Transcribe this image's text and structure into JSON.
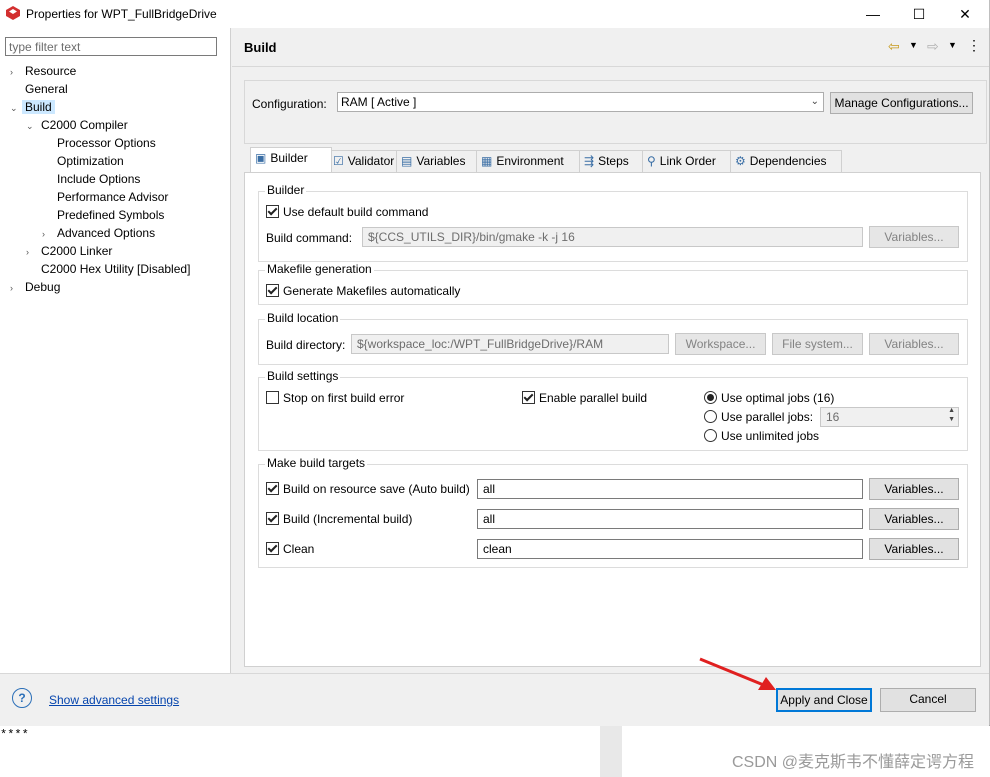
{
  "window": {
    "title": "Properties for WPT_FullBridgeDrive",
    "minimize": "—",
    "maximize": "☐",
    "close": "✕"
  },
  "filter": {
    "placeholder": "type filter text"
  },
  "tree": [
    {
      "label": "Resource",
      "chevron": "›"
    },
    {
      "label": "General",
      "chevron": ""
    },
    {
      "label": "Build",
      "chevron": "⌄",
      "selected": true
    },
    {
      "label": "C2000 Compiler",
      "chevron": "⌄"
    },
    {
      "label": "Processor Options",
      "chevron": ""
    },
    {
      "label": "Optimization",
      "chevron": ""
    },
    {
      "label": "Include Options",
      "chevron": ""
    },
    {
      "label": "Performance Advisor",
      "chevron": ""
    },
    {
      "label": "Predefined Symbols",
      "chevron": ""
    },
    {
      "label": "Advanced Options",
      "chevron": "›"
    },
    {
      "label": "C2000 Linker",
      "chevron": "›"
    },
    {
      "label": "C2000 Hex Utility  [Disabled]",
      "chevron": ""
    },
    {
      "label": "Debug",
      "chevron": "›"
    }
  ],
  "page": {
    "title": "Build"
  },
  "configuration": {
    "label": "Configuration:",
    "value": "RAM  [ Active ]",
    "manage_button": "Manage Configurations..."
  },
  "tabs": [
    "Builder",
    "Validator",
    "Variables",
    "Environment",
    "Steps",
    "Link Order",
    "Dependencies"
  ],
  "builder": {
    "group_title": "Builder",
    "use_default": "Use default build command",
    "build_command_label": "Build command:",
    "build_command_value": "${CCS_UTILS_DIR}/bin/gmake -k -j 16",
    "variables": "Variables..."
  },
  "makefile": {
    "group_title": "Makefile generation",
    "generate": "Generate Makefiles automatically"
  },
  "location": {
    "group_title": "Build location",
    "dir_label": "Build directory:",
    "dir_value": "${workspace_loc:/WPT_FullBridgeDrive}/RAM",
    "workspace": "Workspace...",
    "filesystem": "File system...",
    "variables": "Variables..."
  },
  "settings": {
    "group_title": "Build settings",
    "stop_on_error": "Stop on first build error",
    "parallel": "Enable parallel build",
    "optimal": "Use optimal jobs (16)",
    "parallel_jobs": "Use parallel jobs:",
    "jobs_value": "16",
    "unlimited": "Use unlimited jobs"
  },
  "targets": {
    "group_title": "Make build targets",
    "auto_label": "Build on resource save (Auto build)",
    "auto_value": "all",
    "incr_label": "Build (Incremental build)",
    "incr_value": "all",
    "clean_label": "Clean",
    "clean_value": "clean",
    "variables": "Variables..."
  },
  "footer": {
    "help": "?",
    "advanced": "Show advanced settings",
    "apply": "Apply and Close",
    "cancel": "Cancel"
  },
  "background": {
    "console_text": "****",
    "watermark": "CSDN @麦克斯韦不懂薛定谔方程"
  }
}
